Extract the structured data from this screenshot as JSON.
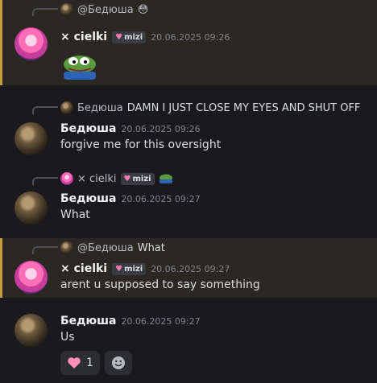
{
  "messages": [
    {
      "reply": {
        "author": "@Бедюша",
        "text": "",
        "emoji": "😳"
      },
      "author": "× cielki",
      "tag": "mizi",
      "time": "20.06.2025 09:26",
      "text": "",
      "sticker": "pepe-sticker"
    },
    {
      "reply": {
        "author": "Бедюша",
        "text": "DAMN I JUST CLOSE MY EYES AND SHUT OFF"
      },
      "author": "Бедюша",
      "time": "20.06.2025 09:26",
      "text": "forgive me for this oversight"
    },
    {
      "reply": {
        "author": "× cielki",
        "tag": "mizi",
        "text": ""
      },
      "author": "Бедюша",
      "time": "20.06.2025 09:27",
      "text": "What"
    },
    {
      "reply": {
        "author": "@Бедюша",
        "text": "What"
      },
      "author": "× cielki",
      "tag": "mizi",
      "time": "20.06.2025 09:27",
      "text": "arent u supposed to say something"
    },
    {
      "author": "Бедюша",
      "time": "20.06.2025 09:27",
      "text": "Us",
      "reactions": [
        {
          "emoji": "heart",
          "count": "1"
        }
      ]
    }
  ],
  "colors": {
    "highlight_bar": "#c59b3c",
    "highlight_bg": "#2b2722",
    "bg": "#1a1a1e"
  }
}
